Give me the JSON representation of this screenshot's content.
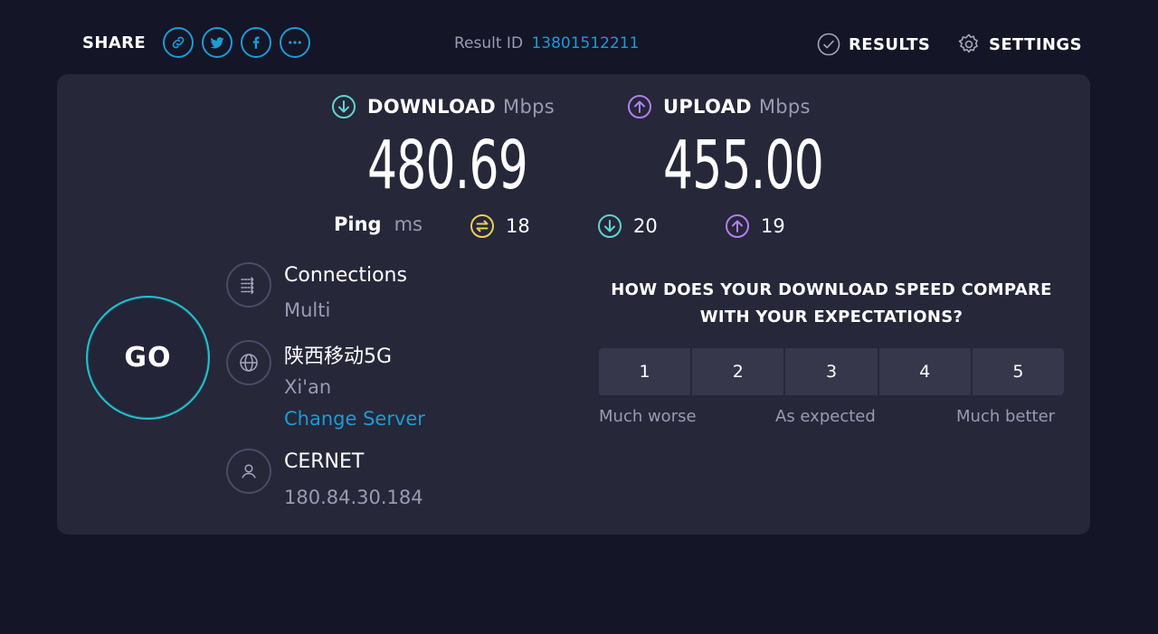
{
  "share": {
    "label": "SHARE"
  },
  "result": {
    "label": "Result ID",
    "id": "13801512211"
  },
  "nav": {
    "results": "RESULTS",
    "settings": "SETTINGS"
  },
  "download": {
    "label": "DOWNLOAD",
    "unit": "Mbps",
    "value": "480.69"
  },
  "upload": {
    "label": "UPLOAD",
    "unit": "Mbps",
    "value": "455.00"
  },
  "ping": {
    "label": "Ping",
    "unit": "ms",
    "idle": "18",
    "download": "20",
    "upload": "19"
  },
  "go": {
    "label": "GO"
  },
  "connections": {
    "title": "Connections",
    "value": "Multi"
  },
  "server": {
    "name": "陕西移动5G",
    "location": "Xi'an",
    "change": "Change Server"
  },
  "isp": {
    "name": "CERNET",
    "ip": "180.84.30.184"
  },
  "survey": {
    "question": "HOW DOES YOUR DOWNLOAD SPEED COMPARE WITH YOUR EXPECTATIONS?",
    "options": [
      "1",
      "2",
      "3",
      "4",
      "5"
    ],
    "low": "Much worse",
    "mid": "As expected",
    "high": "Much better"
  },
  "colors": {
    "accent": "#1c9bd7",
    "download": "#5fd4cf",
    "upload": "#b27ff0",
    "ping": "#e8d05a",
    "go_ring": "#23c0ce"
  }
}
